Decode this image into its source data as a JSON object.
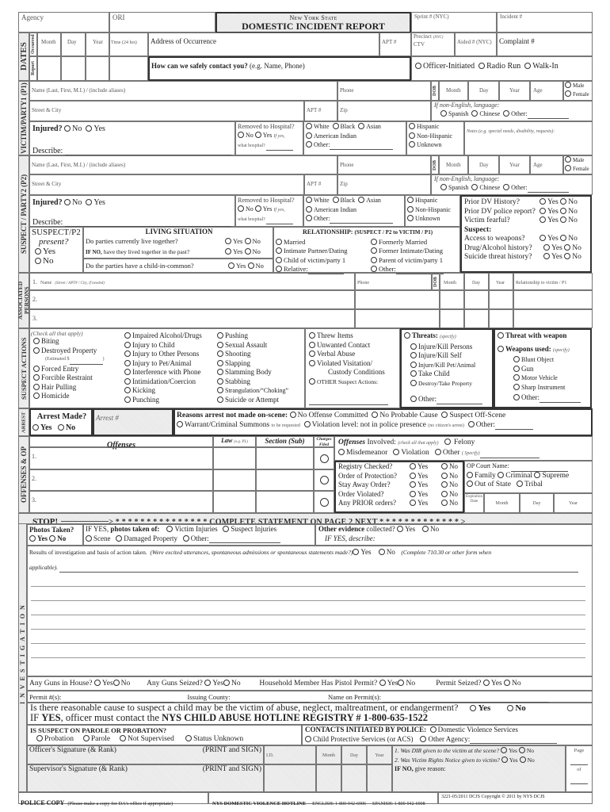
{
  "header": {
    "agency_label": "Agency",
    "ori_label": "ORI",
    "state_label": "New York State",
    "form_title": "DOMESTIC INCIDENT REPORT",
    "sprint_label": "Sprint # (NYC)",
    "incident_label": "Incident #",
    "precinct_label": "Precinct",
    "precinct_sub": "(NYC)",
    "ctv_label": "CTV",
    "aided_label": "Aided # (NYC)",
    "complaint_label": "Complaint #",
    "apt_label": "APT #"
  },
  "dates": {
    "section_label": "DATES",
    "occurred_label": "Occurred",
    "report_label": "Report",
    "month_label": "Month",
    "day_label": "Day",
    "year_label": "Year",
    "time_label": "Time (24 hrs)",
    "address_label": "Address of Occurrence",
    "contact_question": "How can we safely contact you?",
    "contact_hint": "(e.g. Name, Phone)",
    "origin_options": [
      "Officer-Initiated",
      "Radio Run",
      "Walk-In"
    ]
  },
  "victim": {
    "section_label": "VICTIM/PARTY1 (P1)",
    "name_label": "Name (Last, First, M.I.) / (include aliases)",
    "phone_label": "Phone",
    "dob_label": "DOB",
    "month_label": "Month",
    "day_label": "Day",
    "year_label": "Year",
    "age_label": "Age",
    "male_label": "Male",
    "female_label": "Female",
    "street_label": "Street & City",
    "apt_label": "APT #",
    "zip_label": "Zip",
    "language_label": "If non-English, language:",
    "language_options": [
      "Spanish",
      "Chinese",
      "Other:"
    ],
    "injured_label": "Injured?",
    "injured_options": [
      "No",
      "Yes"
    ],
    "describe_label": "Describe:",
    "hospital_label": "Removed to Hospital?",
    "hospital_options": [
      "No",
      "Yes"
    ],
    "hospital_ifyes": "If yes,",
    "what_hospital": "what hospital?",
    "race_options": [
      "White",
      "Black",
      "Asian",
      "American Indian",
      "Other:"
    ],
    "ethnicity_options": [
      "Hispanic",
      "Non-Hispanic",
      "Unknown"
    ],
    "notes_label": "Notes (e.g. special needs, disability, requests):"
  },
  "suspect": {
    "section_label": "SUSPECT / PARTY2 (P2)",
    "name_label": "Name (Last, First, M.I.) / (include aliases)",
    "phone_label": "Phone",
    "dob_label": "DOB",
    "month_label": "Month",
    "day_label": "Day",
    "year_label": "Year",
    "age_label": "Age",
    "male_label": "Male",
    "female_label": "Female",
    "street_label": "Street & City",
    "apt_label": "APT #",
    "zip_label": "Zip",
    "language_label": "If non-English, language:",
    "language_options": [
      "Spanish",
      "Chinese",
      "Other:"
    ],
    "injured_label": "Injured?",
    "injured_options": [
      "No",
      "Yes"
    ],
    "describe_label": "Describe:",
    "hospital_label": "Removed to Hospital?",
    "hospital_options": [
      "No",
      "Yes"
    ],
    "hospital_ifyes": "If yes,",
    "what_hospital": "what hospital?",
    "race_options": [
      "White",
      "Black",
      "Asian",
      "American Indian",
      "Other:"
    ],
    "ethnicity_options": [
      "Hispanic",
      "Non-Hispanic",
      "Unknown"
    ],
    "present_label": "SUSPECT/P2",
    "present_sub": "present?",
    "present_options": [
      "Yes",
      "No"
    ],
    "living_title": "LIVING SITUATION",
    "living_q1": "Do parties currently live together?",
    "living_q2_prefix": "IF NO,",
    "living_q2": "have they lived together in the past?",
    "living_q3": "Do the parties have a child-in-common?",
    "yes": "Yes",
    "no": "No",
    "relationship_title": "RELATIONSHIP:",
    "relationship_sub": "(SUSPECT / P2 to VICTIM / P1)",
    "relationship_options": [
      "Married",
      "Formerly Married",
      "Intimate Partner/Dating",
      "Former Intimate/Dating",
      "Child of victim/party 1",
      "Parent of victim/party 1",
      "Relative:",
      "Other:"
    ],
    "history": [
      {
        "q": "Prior DV History?"
      },
      {
        "q": "Prior DV police report?"
      },
      {
        "q": "Victim fearful?"
      }
    ],
    "suspect_heading": "Suspect:",
    "suspect_history": [
      {
        "q": "Access to weapons?"
      },
      {
        "q": "Drug/Alcohol history?"
      },
      {
        "q": "Suicide threat history?"
      }
    ]
  },
  "associated": {
    "section_label": "ASSOCIATED PERSONS",
    "name_label": "Name",
    "name_hint": "(Street / APT# / City, if needed)",
    "phone_label": "Phone",
    "dob_label": "DOB",
    "month_label": "Month",
    "day_label": "Day",
    "year_label": "Year",
    "relationship_label": "Relationship to victim / P1",
    "rows": [
      "1.",
      "2.",
      "3."
    ]
  },
  "actions": {
    "section_label": "SUSPECT ACTIONS",
    "check_all": "(Check all that apply)",
    "col1": [
      "Biting",
      "Destroyed Property",
      "Forced Entry",
      "Forcible Restraint",
      "Hair Pulling",
      "Homicide"
    ],
    "estimated": "(Estimated $",
    "col2": [
      "Impaired Alcohol/Drugs",
      "Injury to Child",
      "Injury to Other Persons",
      "Injury to Pet/Animal",
      "Interference with Phone",
      "Intimidation/Coercion",
      "Kicking",
      "Punching"
    ],
    "col3": [
      "Pushing",
      "Sexual Assault",
      "Shooting",
      "Slapping",
      "Slamming Body",
      "Stabbing",
      "Strangulation/“Choking”",
      "Suicide or Attempt"
    ],
    "col4": [
      "Threw Items",
      "Unwanted Contact",
      "Verbal Abuse",
      "Violated Visitation/"
    ],
    "col4_cont": "Custody Conditions",
    "other_actions": "OTHER Suspect Actions:",
    "threats_label": "Threats:",
    "threats_hint": "(specify)",
    "threats": [
      "Injure/Kill Persons",
      "Injure/Kill Self",
      "Injure/Kill Pet/Animal",
      "Take Child",
      "Destroy/Take Property",
      "Other:"
    ],
    "threat_weapon": "Threat with weapon",
    "weapons_label": "Weapons used:",
    "weapons_hint": "(specify)",
    "weapons": [
      "Blunt Object",
      "Gun",
      "Motor Vehicle",
      "Sharp Instrument",
      "Other:"
    ]
  },
  "arrest": {
    "section_label": "ARREST",
    "made_label": "Arrest Made?",
    "options": [
      "Yes",
      "No"
    ],
    "number_label": "Arrest #",
    "reasons_label": "Reasons arrest not made on-scene:",
    "reasons": [
      "No Offense Committed",
      "No Probable Cause",
      "Suspect Off-Scene"
    ],
    "warrant": "Warrant/Criminal Summons",
    "warrant_tail": "to be requested",
    "violation": "Violation level: not in police presence",
    "violation_tail": "(no citizen's arrest)",
    "other": "Other:"
  },
  "offenses": {
    "section_label": "OFFENSES & OP",
    "col_offenses": "Offenses",
    "col_law": "Law",
    "col_law_hint": "(e.g. PL)",
    "col_section": "Section (Sub)",
    "col_charges": "Charges Filed",
    "rows": [
      "1.",
      "2.",
      "3."
    ],
    "involved_label": "Offenses",
    "involved_tail": "Involved:",
    "involved_hint": "(check all that apply)",
    "involved_options": [
      "Felony",
      "Misdemeanor",
      "Violation",
      "Other"
    ],
    "specify": "( Specify)",
    "op_questions": [
      "Registry Checked?",
      "Order of Protection?",
      "Stay Away Order?",
      "Order Violated?",
      "Any PRIOR orders?"
    ],
    "yes": "Yes",
    "no": "No",
    "court_label": "OP  Court Name:",
    "court_options": [
      "Family",
      "Criminal",
      "Supreme",
      "Out of State",
      "Tribal"
    ],
    "expiration_label": "Expiration Date",
    "month_label": "Month",
    "day_label": "Day",
    "year_label": "Year"
  },
  "investigation": {
    "section_label": "INVESTIGATION",
    "stop_label": "STOP!",
    "stop_arrow": "> * * * * * * * * * * * * * * * COMPLETE STATEMENT ON PAGE 2 NEXT * * * * * * * * * * * * * >",
    "photos_label": "Photos Taken?",
    "photos_options": [
      "Yes",
      "No"
    ],
    "photos_of_prefix": "IF YES,",
    "photos_of": "photos taken of:",
    "photo_types": [
      "Victim Injuries",
      "Suspect Injuries",
      "Scene",
      "Damaged Property",
      "Other:"
    ],
    "evidence_label": "Other evidence",
    "evidence_tail": "collected?",
    "evidence_options": [
      "Yes",
      "No"
    ],
    "evidence_describe": "IF YES, describe:",
    "results_label": "Results of investigation and basis of action taken.",
    "results_hint": "(Were excited utterances, spontaneous admissions or spontaneous statements made?)",
    "results_options": [
      "Yes",
      "No"
    ],
    "results_note": "(Complete 710.30 or other form when",
    "applicable": "applicable).",
    "guns_house": "Any Guns in House?",
    "guns_seized": "Any Guns Seized?",
    "pistol_permit": "Household Member Has Pistol Permit?",
    "permit_seized": "Permit Seized?",
    "yes": "Yes",
    "no": "No",
    "permit_num": "Permit #(s):",
    "issuing_county": "Issuing County:",
    "name_on_permit": "Name on Permit(s):",
    "child_question": "Is there reasonable cause to suspect a child may be the victim of abuse, neglect, maltreatment, or endangerment?",
    "child_options": [
      "Yes",
      "No"
    ],
    "hotline_prefix": "IF",
    "hotline_yes": "YES",
    "hotline_mid": ", officer must contact the",
    "hotline_name": "NYS CHILD ABUSE HOTLINE REGISTRY # 1-800-635-1522",
    "parole_label": "IS SUSPECT ON PAROLE OR PROBATION?",
    "parole_options": [
      "Probation",
      "Parole",
      "Not Supervised",
      "Status Unknown"
    ],
    "contacts_label": "CONTACTS INITIATED BY POLICE:",
    "contacts_options": [
      "Domestic Violence Services",
      "Child Protective Services (or ACS)",
      "Other Agency:"
    ],
    "officer_sig": "Officer's Signature (& Rank)",
    "supervisor_sig": "Supervisor's Signature (& Rank)",
    "print_sign": "(PRINT and SIGN)",
    "id_label": "I.D.",
    "month_label": "Month",
    "day_label": "Day",
    "year_label": "Year",
    "dir_q": "1. Was DIR given to the victim at the scene?",
    "rights_q": "2. Was Victim Rights Notice given to victim?",
    "ifno_prefix": "IF NO,",
    "ifno": "give reason:",
    "page_label": "Page",
    "of_label": "of"
  },
  "footer": {
    "police_copy": "POLICE  COPY",
    "copy_note": "(Please make a copy for DA's office if  appropriate)",
    "hotline": "NYS DOMESTIC VIOLENCE HOTLINE",
    "english": "ENGLISH: 1-800-942-6906",
    "spanish": "SPANISH: 1-800-942-6908",
    "copyright": "3221-05/2011 DCJS Copyright © 2011 by NYS DCJS"
  }
}
